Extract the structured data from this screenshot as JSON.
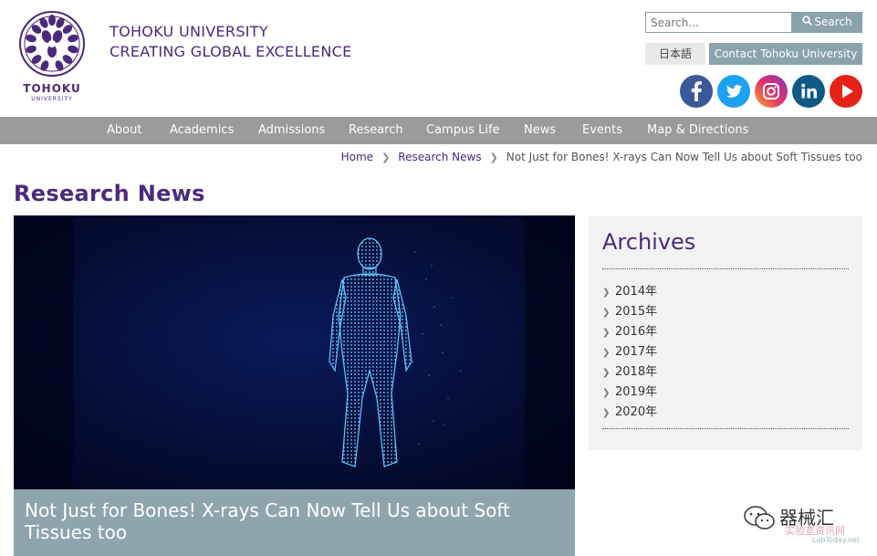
{
  "header": {
    "logo_name": "TOHOKU",
    "logo_sub": "UNIVERSITY",
    "tagline_line1": "TOHOKU UNIVERSITY",
    "tagline_line2": "CREATING GLOBAL EXCELLENCE",
    "search_placeholder": "Search...",
    "search_button": "Search",
    "language_button": "日本語",
    "contact_button": "Contact Tohoku University",
    "social": [
      {
        "name": "facebook-icon",
        "color": "#3b5998"
      },
      {
        "name": "twitter-icon",
        "color": "#1da1f2"
      },
      {
        "name": "instagram-icon",
        "color": "#c13584"
      },
      {
        "name": "linkedin-icon",
        "color": "#0e76a8"
      },
      {
        "name": "youtube-icon",
        "color": "#e62117"
      }
    ]
  },
  "nav": {
    "items": [
      "About",
      "Academics",
      "Admissions",
      "Research",
      "Campus Life",
      "News",
      "Events",
      "Map & Directions"
    ]
  },
  "breadcrumb": {
    "home": "Home",
    "section": "Research News",
    "current": "Not Just for Bones! X-rays Can Now Tell Us about Soft Tissues too"
  },
  "page": {
    "title": "Research News",
    "article_title": "Not Just for Bones! X-rays Can Now Tell Us about Soft Tissues too"
  },
  "archives": {
    "heading": "Archives",
    "years": [
      "2014年",
      "2015年",
      "2016年",
      "2017年",
      "2018年",
      "2019年",
      "2020年"
    ]
  },
  "watermark": {
    "main": "器械汇",
    "sub": "实验室资讯网",
    "url": "LabToday.net"
  },
  "colors": {
    "brand_purple": "#4b2a7b",
    "nav_gray": "#9b9b9b",
    "accent_teal_gray": "#8aa3ad",
    "hero_bg": "#02082a"
  }
}
